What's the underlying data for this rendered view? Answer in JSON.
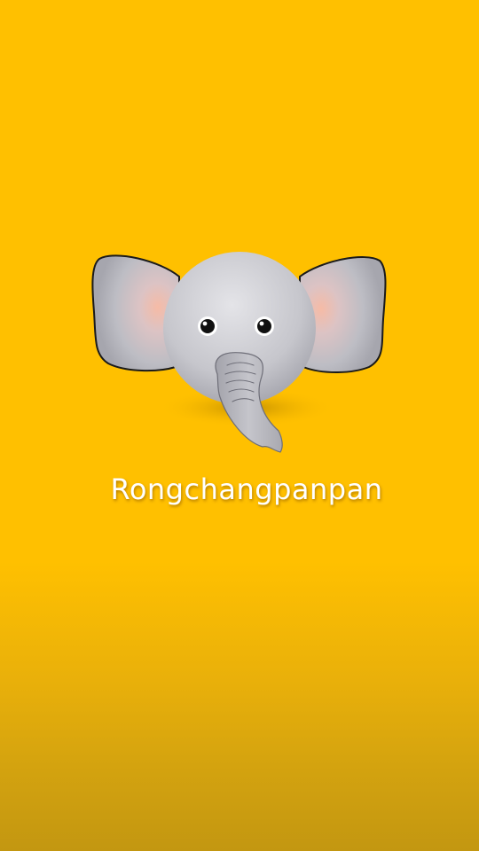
{
  "app": {
    "name": "Rongchangpanpan"
  },
  "logo": {
    "icon": "elephant-icon"
  },
  "colors": {
    "background": "#FFC000",
    "background_bottom": "#C39711",
    "elephant_body": "#C8C8CE",
    "ear_inner": "#F4B9A8",
    "outline": "#1A1A1A",
    "text": "#FFFFFF"
  }
}
